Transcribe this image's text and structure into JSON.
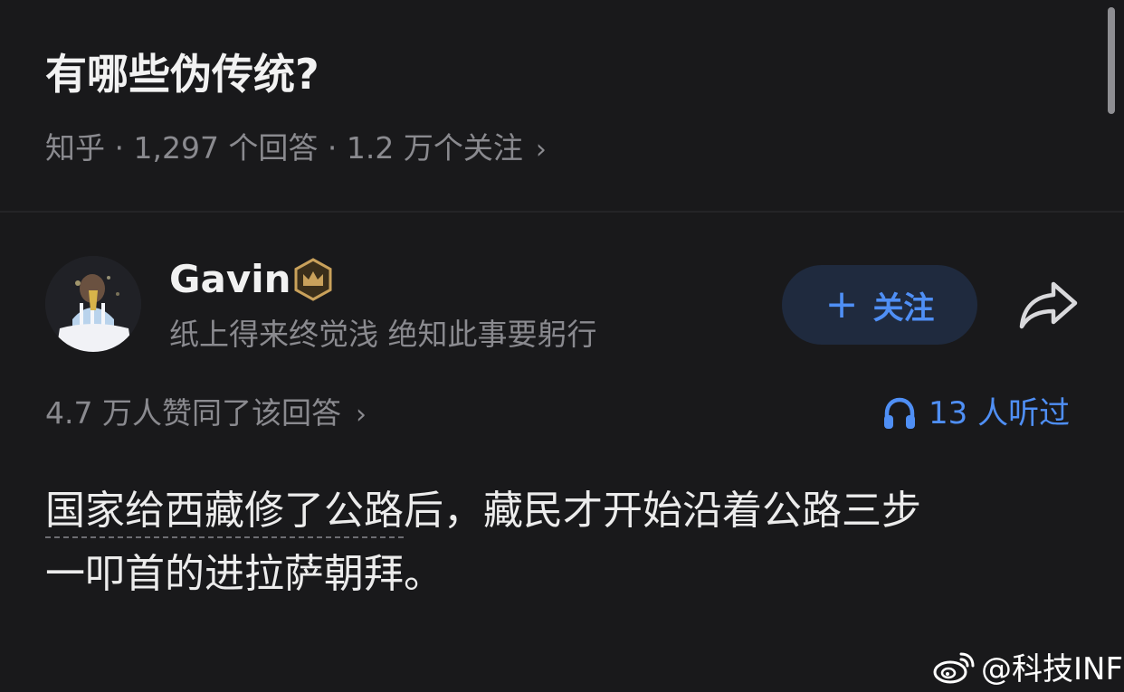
{
  "question": {
    "title": "有哪些伪传统?",
    "meta": "知乎 · 1,297 个回答 · 1.2 万个关注",
    "meta_chevron": "›"
  },
  "author": {
    "name": "Gavin",
    "badge_icon": "crown-badge-icon",
    "bio": "纸上得来终觉浅 绝知此事要躬行",
    "follow_plus": "+",
    "follow_label": "关注",
    "share_icon": "share-icon"
  },
  "stats": {
    "upvotes": "4.7 万人赞同了该回答",
    "upvotes_chevron": "›",
    "listen_icon": "headphones-icon",
    "listeners": "13 人听过"
  },
  "answer": {
    "line1_linked": "国家给西藏修了公路",
    "line1_rest": "后，藏民才开始沿着公路三步",
    "line2": "一叩首的进拉萨朝拜。"
  },
  "watermark": {
    "icon": "weibo-logo-icon",
    "text": "@科技INF"
  },
  "colors": {
    "background": "#19191b",
    "accent": "#4f8ff5",
    "follow_button_bg": "#1f2a3e",
    "secondary_text": "#8a8a8f",
    "badge_gold": "#c9a15b"
  }
}
